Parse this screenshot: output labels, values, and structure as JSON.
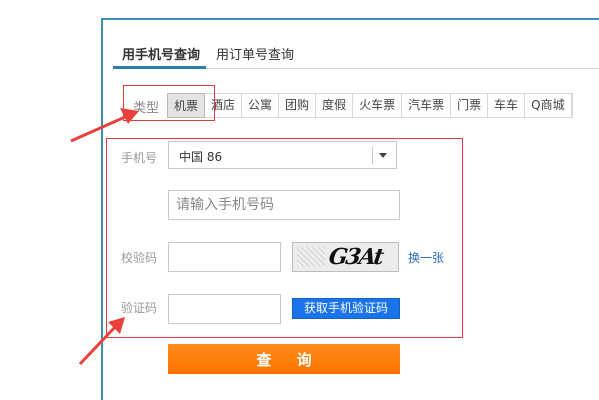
{
  "tabs": [
    {
      "label": "用手机号查询"
    },
    {
      "label": "用订单号查询"
    }
  ],
  "type_filter": {
    "label": "类型",
    "items": [
      {
        "label": "机票"
      },
      {
        "label": "酒店"
      },
      {
        "label": "公寓"
      },
      {
        "label": "团购"
      },
      {
        "label": "度假"
      },
      {
        "label": "火车票"
      },
      {
        "label": "汽车票"
      },
      {
        "label": "门票"
      },
      {
        "label": "车车"
      },
      {
        "label": "Q商城"
      }
    ],
    "selected": "机票"
  },
  "form": {
    "phone_label": "手机号",
    "country_select_value": "中国 86",
    "phone_placeholder": "请输入手机号码",
    "check_code_label": "校验码",
    "check_code_value": "",
    "captcha_text": "G3At",
    "refresh_link": "换一张",
    "verify_code_label": "验证码",
    "verify_code_value": "",
    "get_sms_button": "获取手机验证码",
    "query_button": "查 询"
  },
  "colors": {
    "accent_blue": "#2b7fb0",
    "highlight_red": "#e03c3c",
    "query_orange": "#ff7e0a",
    "sms_blue": "#1a73e8"
  }
}
